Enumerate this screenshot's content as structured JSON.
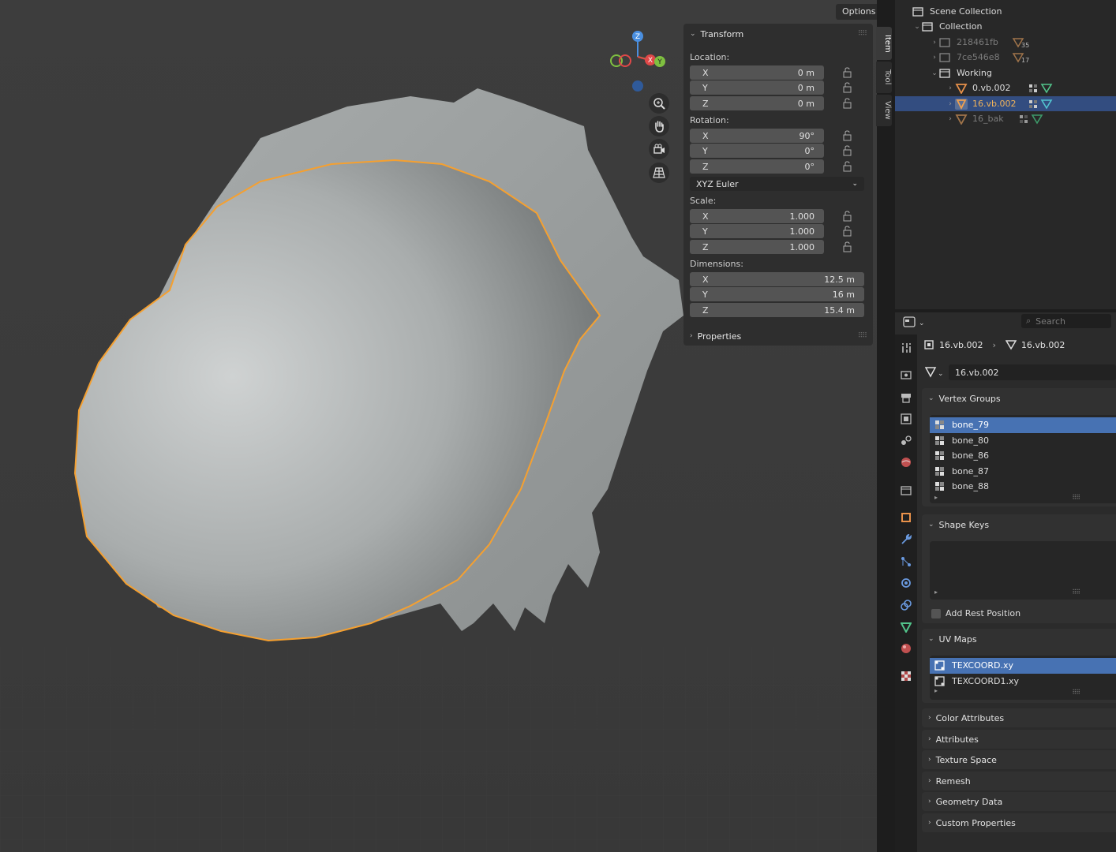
{
  "viewport": {
    "options_label": "Options",
    "gizmo": {
      "z": "Z",
      "x": "X",
      "y": "Y"
    },
    "nav_icons": [
      "zoom-icon",
      "pan-hand-icon",
      "camera-icon",
      "perspective-grid-icon"
    ]
  },
  "side_tabs": [
    "Item",
    "Tool",
    "View"
  ],
  "transform_panel": {
    "title": "Transform",
    "location_label": "Location:",
    "location": {
      "x": "0 m",
      "y": "0 m",
      "z": "0 m"
    },
    "rotation_label": "Rotation:",
    "rotation": {
      "x": "90°",
      "y": "0°",
      "z": "0°"
    },
    "rotation_mode": "XYZ Euler",
    "scale_label": "Scale:",
    "scale": {
      "x": "1.000",
      "y": "1.000",
      "z": "1.000"
    },
    "dimensions_label": "Dimensions:",
    "dimensions": {
      "x": "12.5 m",
      "y": "16 m",
      "z": "15.4 m"
    },
    "axis": {
      "x": "X",
      "y": "Y",
      "z": "Z"
    },
    "properties_label": "Properties"
  },
  "outliner": {
    "scene_collection": "Scene Collection",
    "collection": "Collection",
    "items": [
      {
        "name": "218461fb",
        "badge": "35"
      },
      {
        "name": "7ce546e8",
        "badge": "17"
      }
    ],
    "working": "Working",
    "children": [
      "0.vb.002",
      "16.vb.002",
      "16_bak"
    ]
  },
  "properties": {
    "search_placeholder": "Search",
    "breadcrumb_object": "16.vb.002",
    "breadcrumb_mesh": "16.vb.002",
    "mesh_name": "16.vb.002",
    "vertex_groups_title": "Vertex Groups",
    "vertex_groups": [
      "bone_79",
      "bone_80",
      "bone_86",
      "bone_87",
      "bone_88"
    ],
    "shape_keys_title": "Shape Keys",
    "add_rest_position": "Add Rest Position",
    "uv_maps_title": "UV Maps",
    "uv_maps": [
      "TEXCOORD.xy",
      "TEXCOORD1.xy"
    ],
    "collapsed_panels": [
      "Color Attributes",
      "Attributes",
      "Texture Space",
      "Remesh",
      "Geometry Data",
      "Custom Properties"
    ]
  },
  "colors": {
    "selection_outline": "#f5a030",
    "active_row": "#4772b3",
    "outliner_selected": "#334d80",
    "mesh_icon_orange": "#e8914a",
    "vgroup_green": "#52c48a"
  }
}
